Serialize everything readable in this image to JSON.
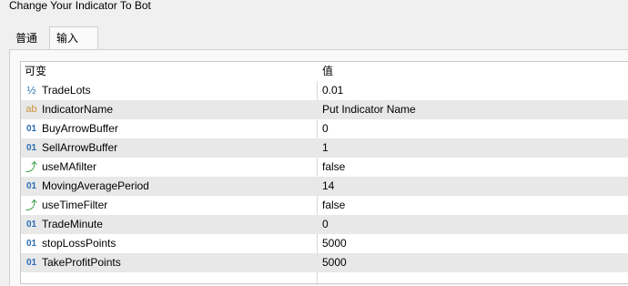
{
  "window": {
    "title": "Change Your Indicator To Bot"
  },
  "tabs": [
    {
      "label": "普通"
    },
    {
      "label": "输入"
    }
  ],
  "grid": {
    "headers": {
      "name": "可变",
      "value": "值"
    },
    "rows": [
      {
        "icon": "fraction-icon",
        "glyph": "½",
        "name": "TradeLots",
        "value": "0.01"
      },
      {
        "icon": "string-icon",
        "glyph": "ab",
        "name": "IndicatorName",
        "value": "Put Indicator Name"
      },
      {
        "icon": "integer-icon",
        "glyph": "01",
        "name": "BuyArrowBuffer",
        "value": "0"
      },
      {
        "icon": "integer-icon",
        "glyph": "01",
        "name": "SellArrowBuffer",
        "value": "1"
      },
      {
        "icon": "boolean-icon",
        "glyph": "⤴",
        "name": "useMAfilter",
        "value": "false"
      },
      {
        "icon": "integer-icon",
        "glyph": "01",
        "name": "MovingAveragePeriod",
        "value": "14"
      },
      {
        "icon": "boolean-icon",
        "glyph": "⤴",
        "name": "useTimeFilter",
        "value": "false"
      },
      {
        "icon": "integer-icon",
        "glyph": "01",
        "name": "TradeMinute",
        "value": "0"
      },
      {
        "icon": "integer-icon",
        "glyph": "01",
        "name": "stopLossPoints",
        "value": "5000"
      },
      {
        "icon": "integer-icon",
        "glyph": "01",
        "name": "TakeProfitPoints",
        "value": "5000"
      }
    ]
  }
}
